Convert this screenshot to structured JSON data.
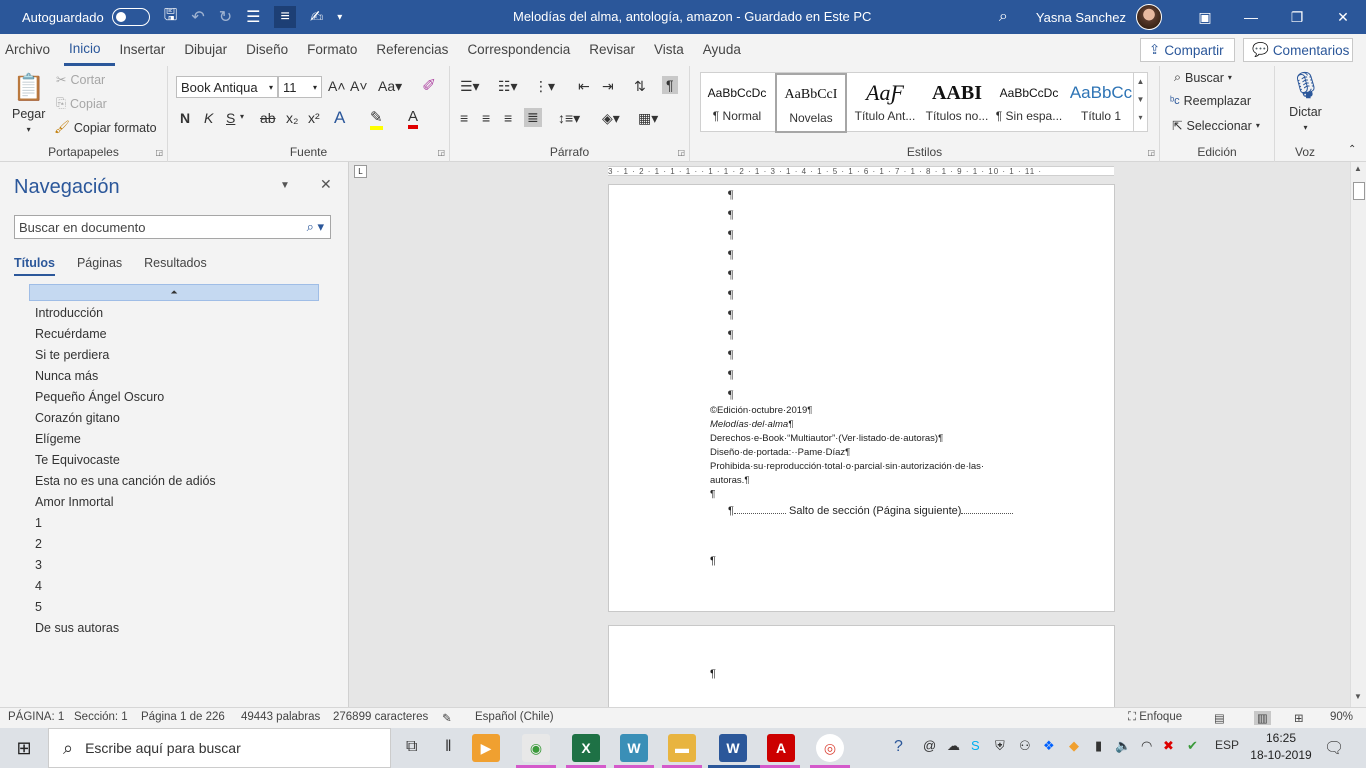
{
  "titlebar": {
    "autosave_label": "Autoguardado",
    "document_title": "Melodías del alma, antología, amazon  -  Guardado en Este PC",
    "user_name": "Yasna Sanchez"
  },
  "tabs": [
    "Archivo",
    "Inicio",
    "Insertar",
    "Dibujar",
    "Diseño",
    "Formato",
    "Referencias",
    "Correspondencia",
    "Revisar",
    "Vista",
    "Ayuda"
  ],
  "share_label": "Compartir",
  "comments_label": "Comentarios",
  "ribbon": {
    "clipboard": {
      "paste": "Pegar",
      "cut": "Cortar",
      "copy": "Copiar",
      "format_painter": "Copiar formato",
      "label": "Portapapeles"
    },
    "font": {
      "name": "Book Antiqua",
      "size": "11",
      "label": "Fuente",
      "bold": "N",
      "italic": "K",
      "underline": "S",
      "strike": "ab",
      "sub": "x₂",
      "sup": "x²"
    },
    "paragraph": {
      "label": "Párrafo"
    },
    "styles": {
      "label": "Estilos",
      "items": [
        {
          "sample": "AaBbCcDc",
          "name": "¶ Normal"
        },
        {
          "sample": "AaBbCcI",
          "name": "Novelas"
        },
        {
          "sample": "AaƑ",
          "name": "Título Ant..."
        },
        {
          "sample": "AABI",
          "name": "Títulos no..."
        },
        {
          "sample": "AaBbCcDc",
          "name": "¶ Sin espa..."
        },
        {
          "sample": "AaBbCc",
          "name": "Título 1"
        }
      ]
    },
    "editing": {
      "find": "Buscar",
      "replace": "Reemplazar",
      "select": "Seleccionar",
      "label": "Edición"
    },
    "voice": {
      "dictate": "Dictar",
      "label": "Voz"
    }
  },
  "navigation": {
    "title": "Navegación",
    "search_placeholder": "Buscar en documento",
    "tabs": [
      "Títulos",
      "Páginas",
      "Resultados"
    ],
    "headings": [
      "Introducción",
      "Recuérdame",
      "Si te perdiera",
      "Nunca más",
      "Pequeño Ángel Oscuro",
      "Corazón gitano",
      "Elígeme",
      "Te Equivocaste",
      "Esta no es una canción de adiós",
      "Amor Inmortal",
      "1",
      "2",
      "3",
      "4",
      "5",
      "De sus autoras"
    ]
  },
  "ruler_text": "3 · 1 · 2 · 1 · 1 · 1 ·   · 1 · 1 · 2 · 1 · 3 · 1 · 4 · 1 · 5 · 1 · 6 · 1 · 7 · 1 · 8 · 1 · 9 · 1 · 10 · 1 · 11 ·",
  "document": {
    "pilcrow": "¶",
    "lines": [
      "©Edición·octubre·2019¶",
      "Melodías·del·alma¶",
      "Derechos·e-Book·“Multiautor”·(Ver·listado·de·autoras)¶",
      "Diseño·de·portada:··Pame·Díaz¶",
      "Prohibida·su·reproducción·total·o·parcial·sin·autorización·de·las·",
      "autoras.¶"
    ],
    "section_break": "Salto de sección (Página siguiente)"
  },
  "status": {
    "page": "PÁGINA: 1",
    "section": "Sección: 1",
    "page_of": "Página 1 de 226",
    "words": "49443 palabras",
    "chars": "276899 caracteres",
    "language": "Español (Chile)",
    "focus": "Enfoque",
    "zoom": "90%"
  },
  "taskbar": {
    "search_placeholder": "Escribe aquí para buscar",
    "lang": "ESP",
    "time": "16:25",
    "date": "18-10-2019"
  }
}
